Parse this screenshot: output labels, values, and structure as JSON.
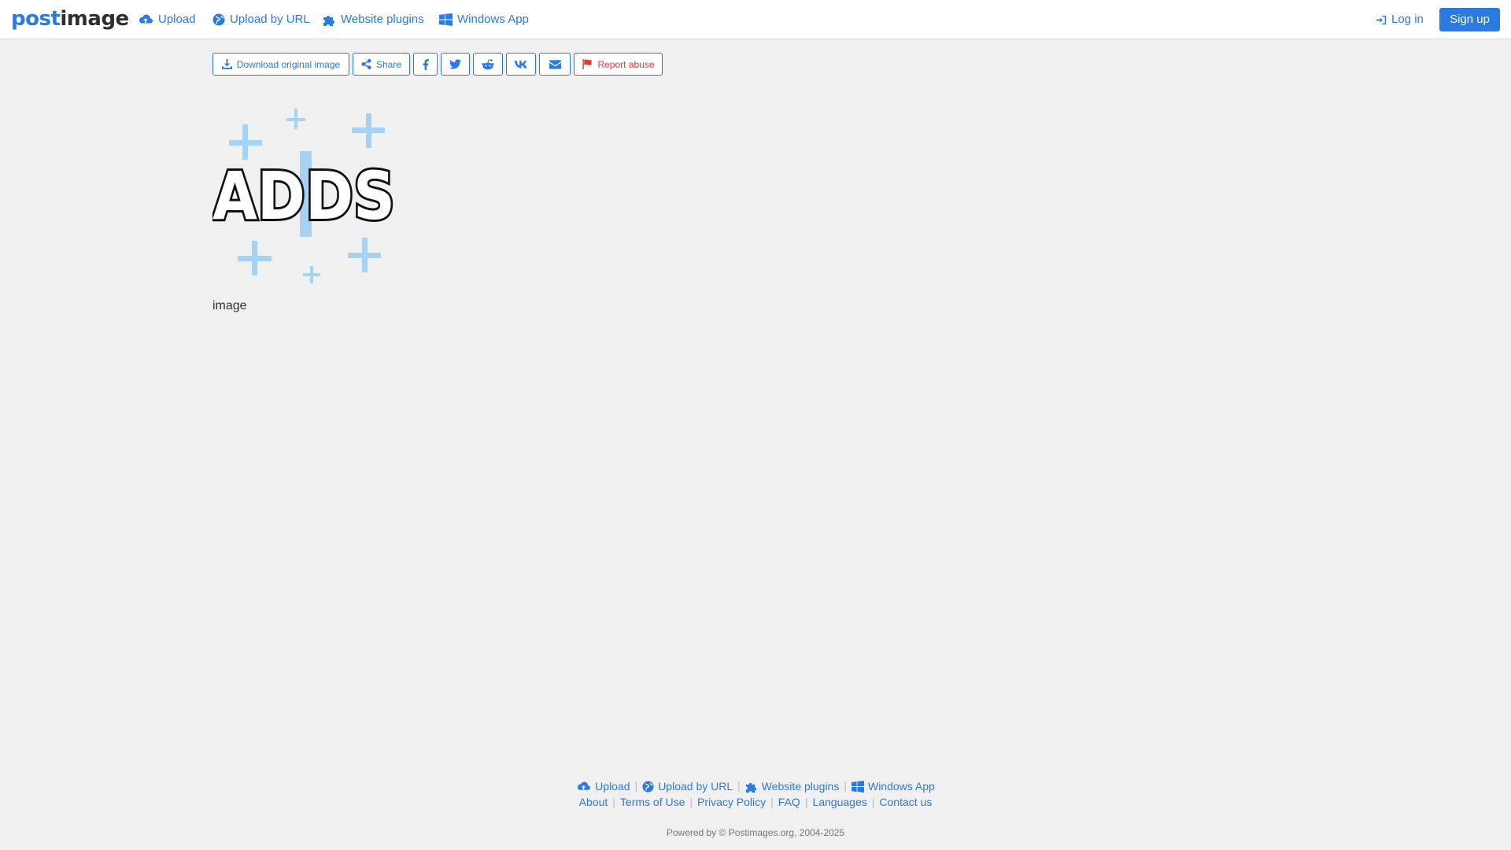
{
  "colors": {
    "accent": "#2a7ae2",
    "danger": "#e03b3b",
    "background": "#f0f0f0"
  },
  "header": {
    "logo": {
      "part1": "post",
      "part2": "image"
    },
    "nav": [
      {
        "label": "Upload",
        "icon": "cloud-upload-icon"
      },
      {
        "label": "Upload by URL",
        "icon": "globe-icon"
      },
      {
        "label": "Website plugins",
        "icon": "puzzle-icon"
      },
      {
        "label": "Windows App",
        "icon": "windows-icon"
      }
    ],
    "login_label": "Log in",
    "signup_label": "Sign up"
  },
  "toolbar": {
    "download_label": "Download original image",
    "share_label": "Share",
    "social_icons": [
      "facebook-icon",
      "twitter-icon",
      "reddit-icon",
      "vk-icon",
      "envelope-icon"
    ],
    "report_label": "Report abuse"
  },
  "image": {
    "text": "ADDS",
    "caption": "image"
  },
  "footer": {
    "nav": [
      {
        "label": "Upload",
        "icon": "cloud-upload-icon"
      },
      {
        "label": "Upload by URL",
        "icon": "globe-icon"
      },
      {
        "label": "Website plugins",
        "icon": "puzzle-icon"
      },
      {
        "label": "Windows App",
        "icon": "windows-icon"
      }
    ],
    "links": [
      "About",
      "Terms of Use",
      "Privacy Policy",
      "FAQ",
      "Languages",
      "Contact us"
    ],
    "powered": "Powered by © Postimages.org, 2004-2025"
  }
}
